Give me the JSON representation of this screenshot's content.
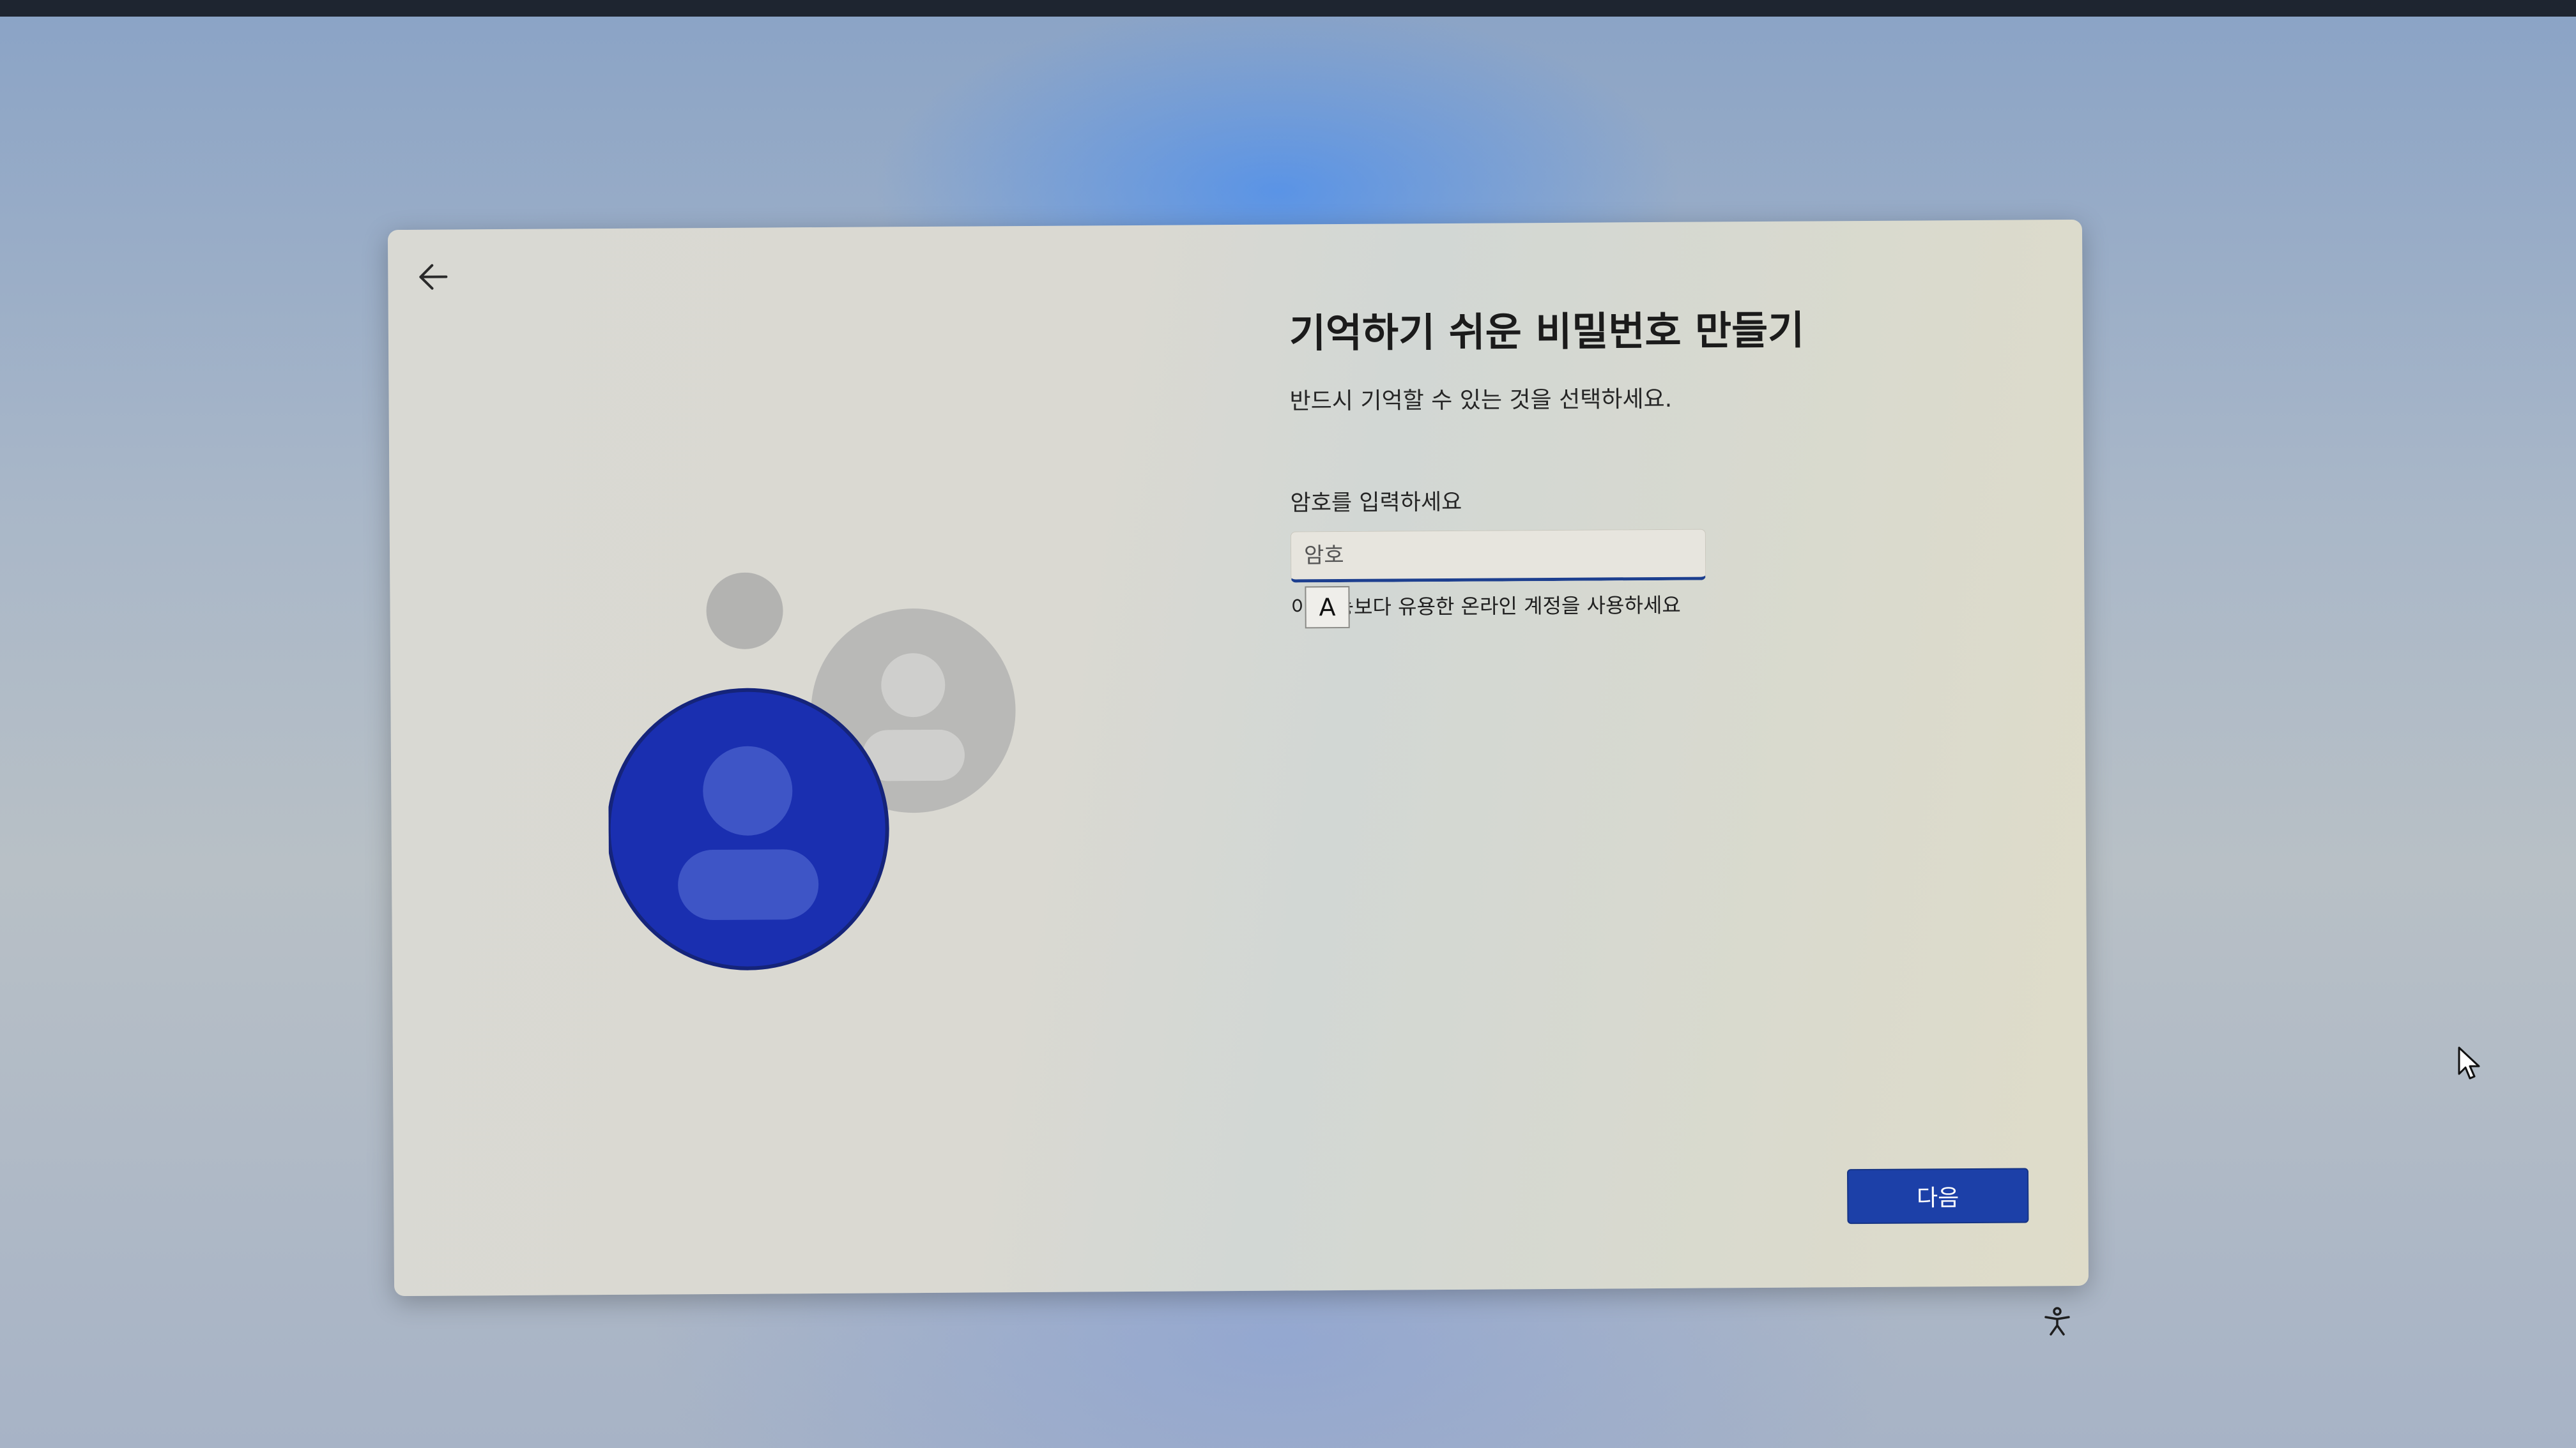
{
  "setup": {
    "title": "기억하기 쉬운 비밀번호 만들기",
    "subtitle": "반드시 기억할 수 있는 것을 선택하세요.",
    "password_label": "암호를 입력하세요",
    "password_placeholder": "암호",
    "password_value": "",
    "ime_mode": "A",
    "online_account_link": "이 기능보다 유용한 온라인 계정을 사용하세요",
    "next_label": "다음"
  },
  "icons": {
    "back": "back-arrow-icon",
    "accessibility": "accessibility-icon",
    "cursor": "mouse-pointer-icon"
  },
  "colors": {
    "accent": "#1c40a8",
    "avatar_primary": "#1a2fb0",
    "avatar_secondary": "#b3b3b1"
  }
}
